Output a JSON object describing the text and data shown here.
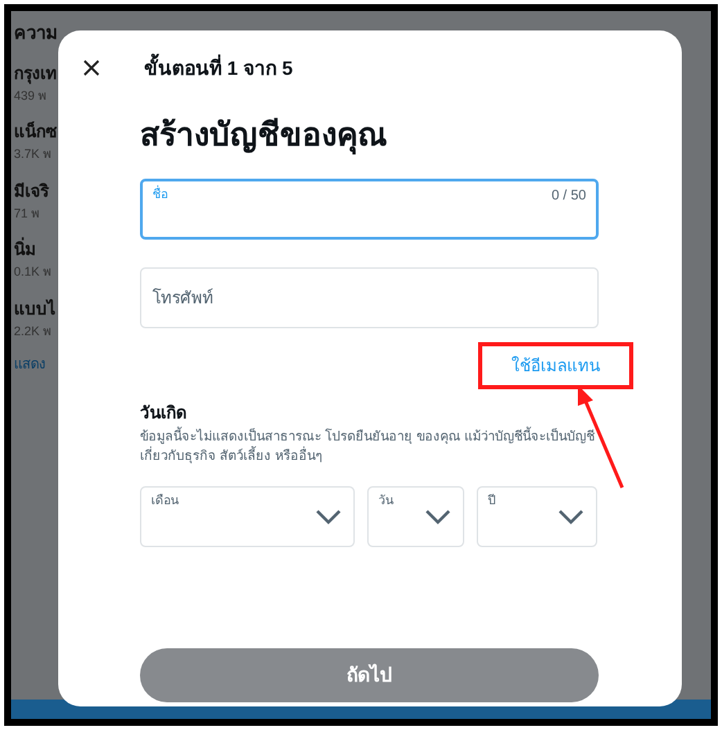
{
  "background": {
    "heading": "ความ",
    "trends": [
      {
        "title": "กรุงเท",
        "count": "439 พ"
      },
      {
        "title": "แน็กซ",
        "count": "3.7K พ"
      },
      {
        "title": "มีเจริ",
        "count": "71 พ"
      },
      {
        "title": "นิ่ม",
        "count": "0.1K พ"
      },
      {
        "title": "แบบไ",
        "count": "2.2K พ"
      }
    ],
    "show_more": "แสดง"
  },
  "dialog": {
    "step": "ขั้นตอนที่ 1 จาก 5",
    "title": "สร้างบัญชีของคุณ",
    "fields": [
      {
        "label": "ชื่อ",
        "counter": "0 / 50",
        "focused": true
      },
      {
        "placeholder": "โทรศัพท์",
        "focused": false
      }
    ],
    "switch_link": "ใช้อีเมลแทน",
    "birthday": {
      "label": "วันเกิด",
      "note": "ข้อมูลนี้จะไม่แสดงเป็นสาธารณะ โปรดยืนยันอายุ ของคุณ แม้ว่าบัญชีนี้จะเป็นบัญชีเกี่ยวกับธุรกิจ สัตว์เลี้ยง หรืออื่นๆ",
      "selects": [
        {
          "label": "เดือน"
        },
        {
          "label": "วัน"
        },
        {
          "label": "ปี"
        }
      ]
    },
    "next_button": {
      "label": "ถัดไป",
      "disabled": true
    }
  },
  "annotation": {
    "highlight": true
  }
}
